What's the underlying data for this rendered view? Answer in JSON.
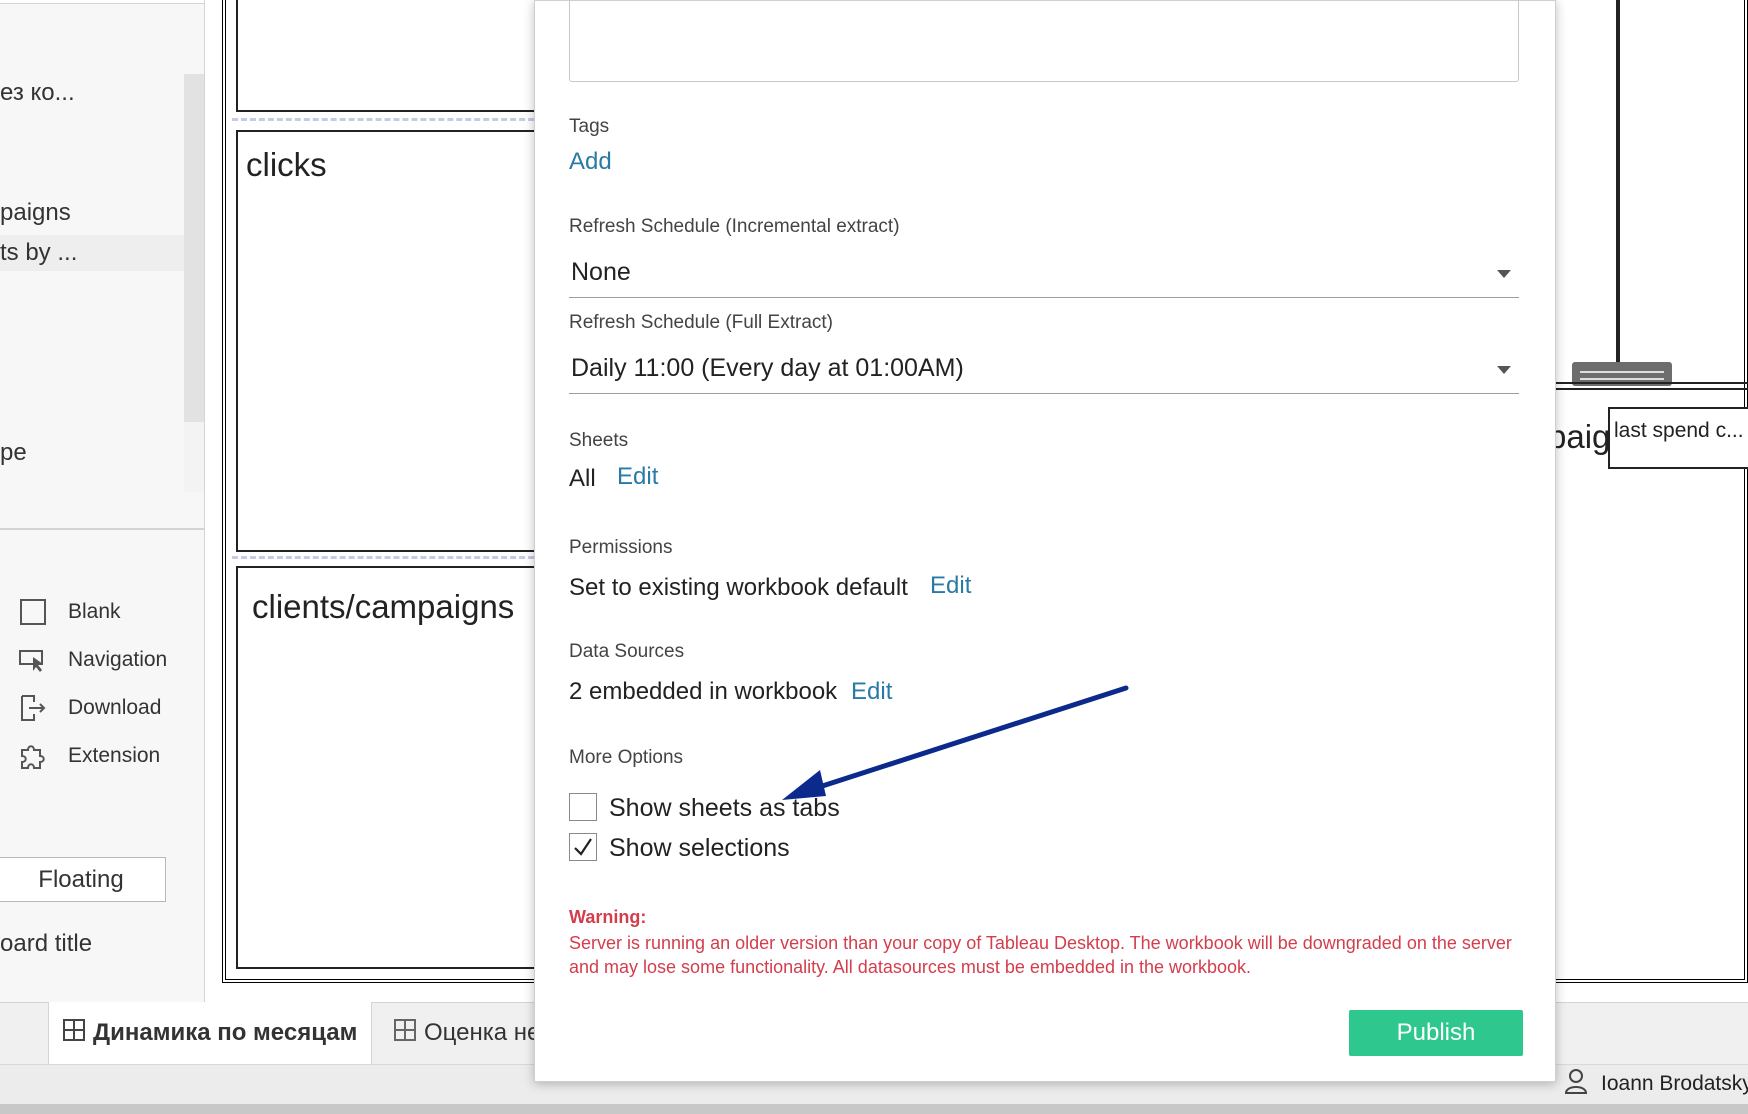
{
  "left_panel": {
    "sheets": [
      {
        "label": "ез ко..."
      },
      {
        "label": "paigns"
      },
      {
        "label": "ts by ..."
      },
      {
        "label": "pe"
      }
    ],
    "objects": [
      {
        "label": "Blank",
        "icon": "blank-icon"
      },
      {
        "label": "Navigation",
        "icon": "navigation-icon"
      },
      {
        "label": "Download",
        "icon": "download-icon"
      },
      {
        "label": "Extension",
        "icon": "extension-icon"
      }
    ],
    "floating_label": "Floating",
    "show_title_label": "oard title"
  },
  "canvas": {
    "zones": [
      {
        "title": ""
      },
      {
        "title": "clicks"
      },
      {
        "title": "clients/campaigns"
      }
    ],
    "right_partial_title": "paign",
    "right_tooltip": "last spend c..."
  },
  "dialog": {
    "tags_label": "Tags",
    "tags_add": "Add",
    "refresh_incremental_label": "Refresh Schedule (Incremental extract)",
    "refresh_incremental_value": "None",
    "refresh_full_label": "Refresh Schedule (Full Extract)",
    "refresh_full_value": "Daily 11:00 (Every day at 01:00AM)",
    "sheets_label": "Sheets",
    "sheets_value": "All",
    "sheets_edit": "Edit",
    "permissions_label": "Permissions",
    "permissions_value": "Set to existing workbook default",
    "permissions_edit": "Edit",
    "data_sources_label": "Data Sources",
    "data_sources_value": "2 embedded in workbook",
    "data_sources_edit": "Edit",
    "more_options_label": "More Options",
    "options": [
      {
        "label": "Show sheets as tabs",
        "checked": false
      },
      {
        "label": "Show selections",
        "checked": true
      }
    ],
    "warning_title": "Warning:",
    "warning_text": "Server is running an older version than your copy of Tableau Desktop. The workbook will be downgraded on the server and may lose some functionality. All datasources must be embedded in the workbook.",
    "publish_label": "Publish"
  },
  "bottom": {
    "tabs": [
      {
        "label": "Динамика по месяцам",
        "active": true
      },
      {
        "label": "Оценка не",
        "active": false
      }
    ],
    "user_name": "Ioann Brodatsky"
  },
  "colors": {
    "link": "#2a7aa6",
    "warning": "#d43d4c",
    "publish_button": "#2ec78e",
    "annotation_arrow": "#0b2a8c"
  }
}
